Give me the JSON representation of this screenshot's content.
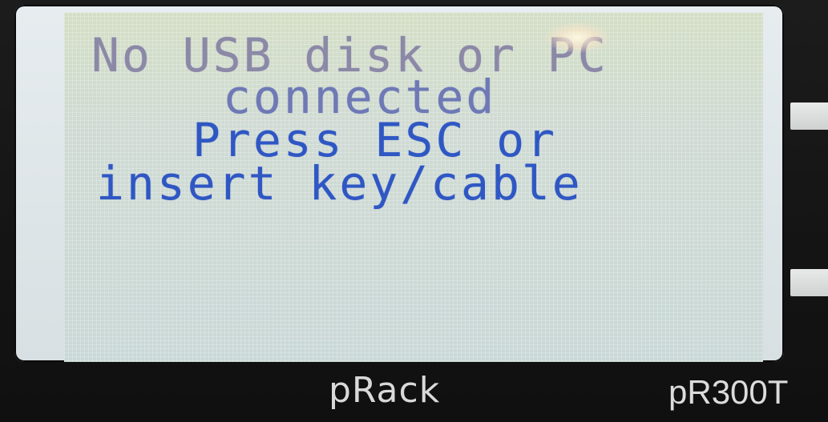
{
  "display": {
    "lines": [
      "No USB disk or PC",
      "connected",
      "Press ESC or",
      "insert key/cable"
    ],
    "text_color": "#2f57c4",
    "background_color": "#cdd9cf"
  },
  "device": {
    "brand": "pRack",
    "model": "pR300T"
  }
}
